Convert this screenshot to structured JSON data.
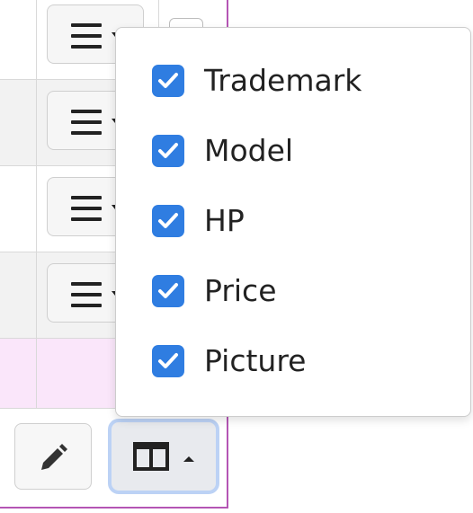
{
  "dropdown": {
    "options": [
      {
        "label": "Trademark",
        "checked": true
      },
      {
        "label": "Model",
        "checked": true
      },
      {
        "label": "HP",
        "checked": true
      },
      {
        "label": "Price",
        "checked": true
      },
      {
        "label": "Picture",
        "checked": true
      }
    ]
  },
  "icons": {
    "row_menu": "hamburger-icon",
    "edit": "pencil-icon",
    "columns": "columns-icon",
    "check": "checkmark-icon"
  },
  "colors": {
    "checkbox": "#2f7de1",
    "accent_border": "#b455b4",
    "selected_row": "#fae6fa",
    "active_button_ring": "#bcd2f5"
  }
}
